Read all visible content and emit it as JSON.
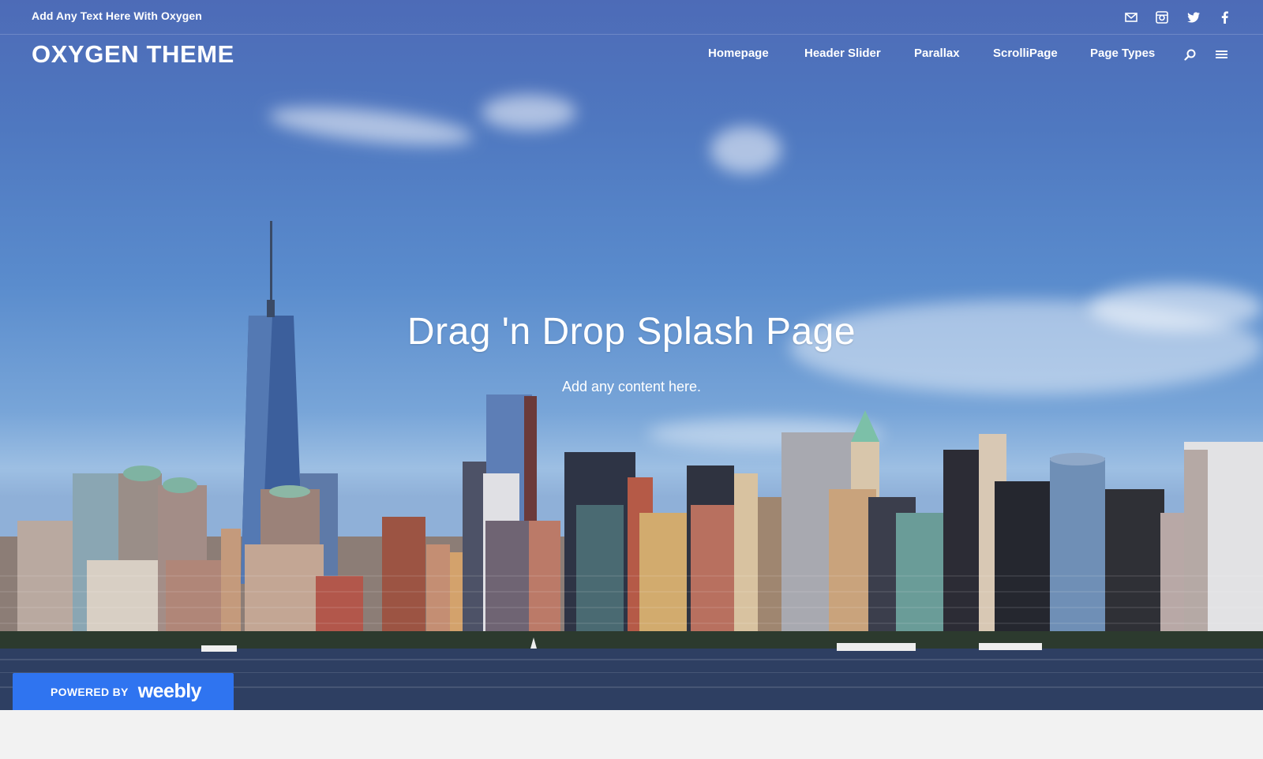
{
  "topbar": {
    "tagline": "Add Any Text Here With Oxygen",
    "social_icons": [
      "mail-icon",
      "instagram-icon",
      "twitter-icon",
      "facebook-icon"
    ]
  },
  "header": {
    "site_title": "OXYGEN THEME",
    "nav": [
      "Homepage",
      "Header Slider",
      "Parallax",
      "ScrolliPage",
      "Page Types"
    ],
    "tools": [
      "search-icon",
      "menu-icon"
    ]
  },
  "hero": {
    "title": "Drag 'n Drop Splash Page",
    "subtitle": "Add any content here."
  },
  "badge": {
    "powered_by": "POWERED BY",
    "brand": "weebly"
  },
  "colors": {
    "badge_blue": "#2f74f0",
    "sky_top": "#4d6bb7",
    "water": "#2e3f62",
    "footer_bg": "#f2f2f2"
  }
}
